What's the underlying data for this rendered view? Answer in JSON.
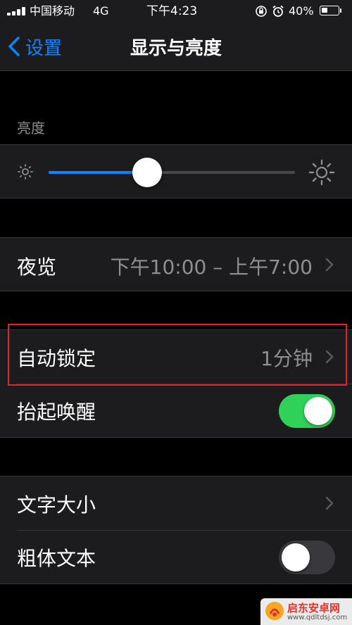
{
  "status_bar": {
    "carrier": "中国移动",
    "network": "4G",
    "time": "下午4:23",
    "battery_percent": "40%",
    "battery_level": 0.4,
    "icons": [
      "signal-icon",
      "orientation-lock-icon",
      "alarm-icon",
      "battery-icon"
    ]
  },
  "nav": {
    "back_label": "设置",
    "title": "显示与亮度"
  },
  "brightness": {
    "header": "亮度",
    "level": 0.4,
    "icons": [
      "sun-small-icon",
      "sun-large-icon"
    ]
  },
  "night_shift": {
    "label": "夜览",
    "value": "下午10:00 – 上午7:00"
  },
  "auto_lock": {
    "label": "自动锁定",
    "value": "1分钟"
  },
  "raise_to_wake": {
    "label": "抬起唤醒",
    "on": true
  },
  "text_size": {
    "label": "文字大小"
  },
  "bold_text": {
    "label": "粗体文本",
    "on": false
  },
  "watermark": {
    "title": "启东安卓网",
    "url": "www.qdltdsj.com"
  },
  "colors": {
    "accent": "#0a84ff",
    "toggle_on": "#30d158",
    "toggle_off": "#39393d",
    "highlight": "#e0242a"
  }
}
